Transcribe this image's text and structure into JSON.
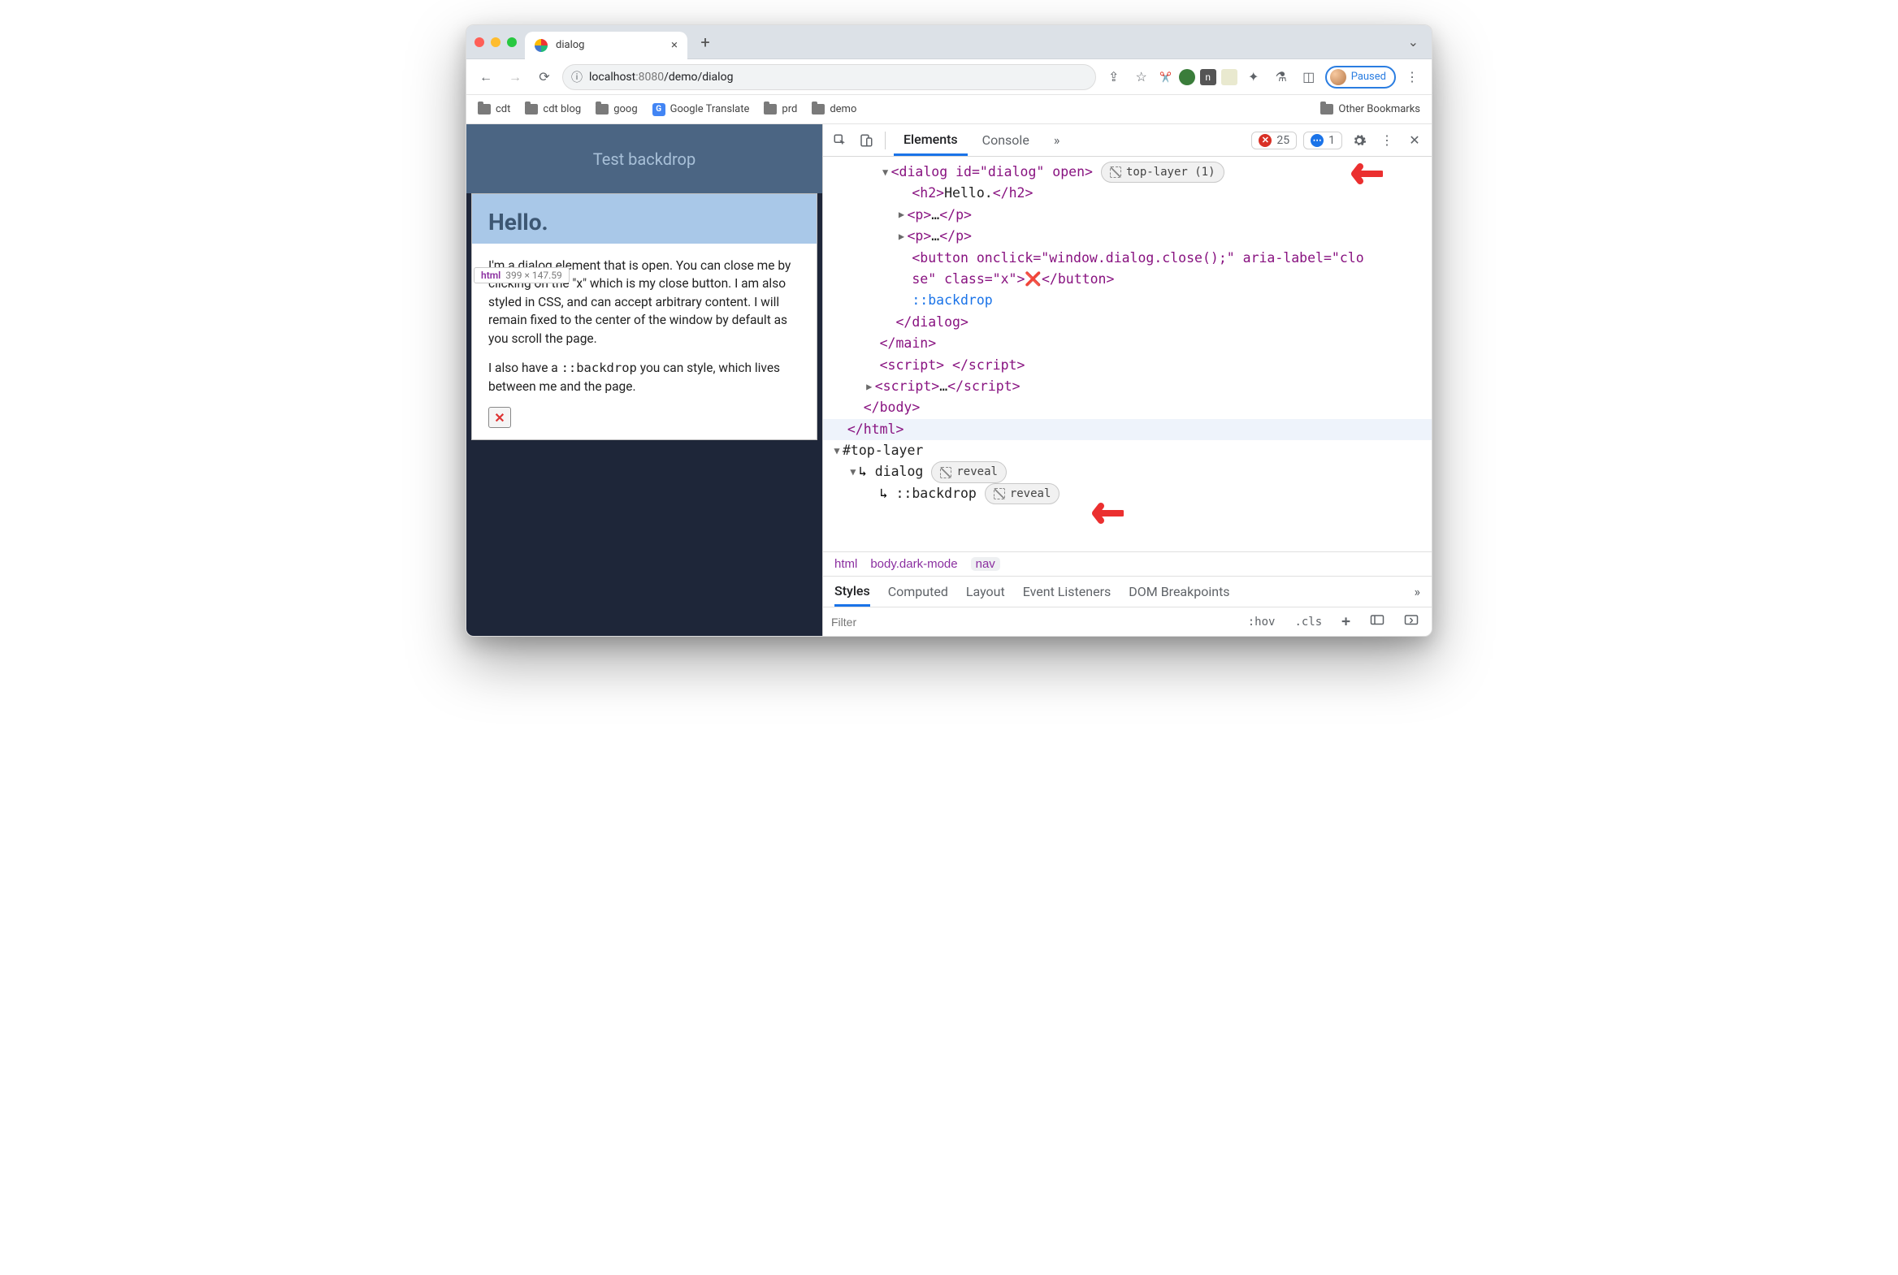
{
  "tab": {
    "title": "dialog"
  },
  "toolbar": {
    "url_host": "localhost",
    "url_port": ":8080",
    "url_path": "/demo/dialog",
    "profile_label": "Paused"
  },
  "bookmarks": {
    "items": [
      "cdt",
      "cdt blog",
      "goog",
      "Google Translate",
      "prd",
      "demo"
    ],
    "other": "Other Bookmarks"
  },
  "page": {
    "header": "Test backdrop",
    "dialog_title": "Hello.",
    "tooltip_tag": "html",
    "tooltip_dims": "399 × 147.59",
    "p1": "I'm a dialog element that is open. You can close me by clicking on the \"x\" which is my close button. I am also styled in CSS, and can accept arbitrary content. I will remain fixed to the center of the window by default as you scroll the page.",
    "p2_a": "I also have a ",
    "p2_code": "::backdrop",
    "p2_b": " you can style, which lives between me and the page.",
    "close_glyph": "✕"
  },
  "devtools": {
    "tabs": {
      "elements": "Elements",
      "console": "Console",
      "more": "»"
    },
    "errors": "25",
    "infos": "1",
    "dom": {
      "dialog_open": "<dialog id=\"dialog\" open>",
      "top_layer_badge": "top-layer (1)",
      "h2": "<h2>",
      "h2_text": "Hello.",
      "h2_close": "</h2>",
      "p_collapsed_a": "<p>",
      "ellipsis": "…",
      "p_collapsed_b": "</p>",
      "button_a": "<button onclick=\"window.dialog.close();\" aria-label=\"clo",
      "button_b": "se\" class=\"x\">",
      "button_glyph": "❌",
      "button_close": "</button>",
      "backdrop": "::backdrop",
      "dialog_close": "</dialog>",
      "main_close": "</main>",
      "script_empty": "<script> </script>",
      "script_collapsed_a": "<script>",
      "script_collapsed_b": "</script>",
      "body_close": "</body>",
      "html_close": "</html>",
      "top_layer_node": "#top-layer",
      "tl_dialog": "dialog",
      "tl_backdrop": "::backdrop",
      "reveal": "reveal"
    },
    "crumbs": [
      "html",
      "body.dark-mode",
      "nav"
    ],
    "styles_tabs": [
      "Styles",
      "Computed",
      "Layout",
      "Event Listeners",
      "DOM Breakpoints"
    ],
    "filter_placeholder": "Filter",
    "tools": {
      "hov": ":hov",
      "cls": ".cls",
      "plus": "+"
    }
  }
}
